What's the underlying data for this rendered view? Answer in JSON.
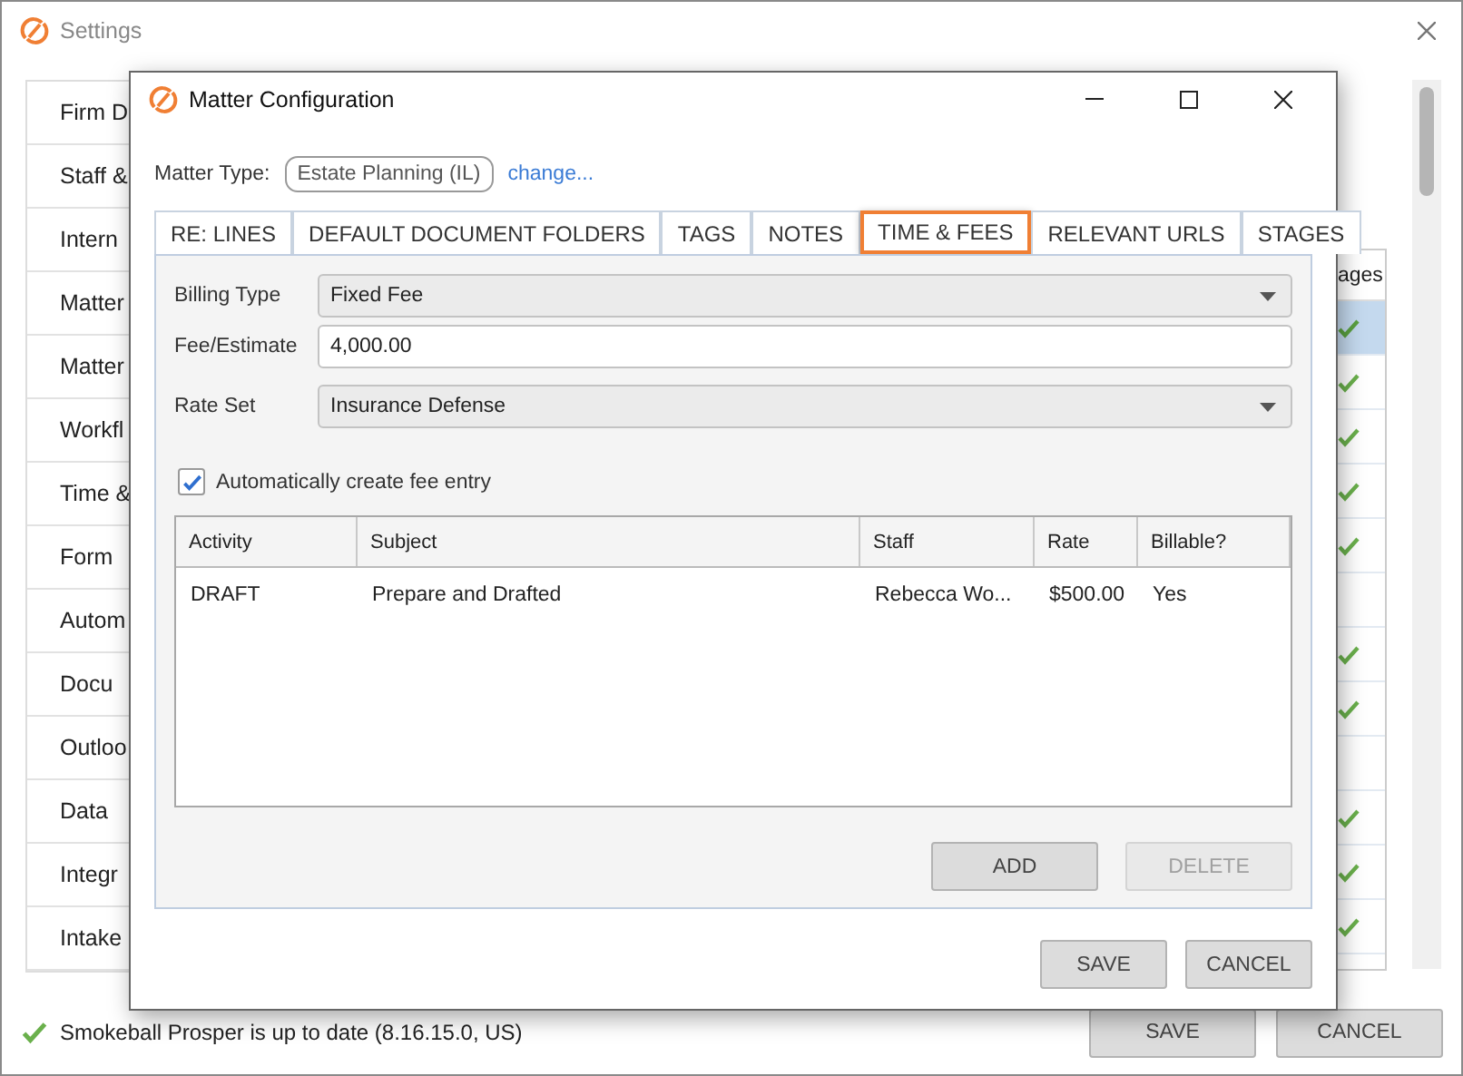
{
  "settings": {
    "title": "Settings",
    "nav_items": [
      {
        "label": "Firm D"
      },
      {
        "label": "Staff &"
      },
      {
        "label": "Intern"
      },
      {
        "label": "Matter"
      },
      {
        "label": "Matter"
      },
      {
        "label": "Workfl"
      },
      {
        "label": "Time &"
      },
      {
        "label": "Form"
      },
      {
        "label": "Autom"
      },
      {
        "label": "Docu"
      },
      {
        "label": "Outloo"
      },
      {
        "label": "Data"
      },
      {
        "label": "Integr"
      },
      {
        "label": "Intake"
      }
    ],
    "column_header": "ages",
    "rows": [
      {
        "checked": true,
        "selected": true
      },
      {
        "checked": true,
        "selected": false
      },
      {
        "checked": true,
        "selected": false
      },
      {
        "checked": true,
        "selected": false
      },
      {
        "checked": true,
        "selected": false
      },
      {
        "checked": false,
        "selected": false
      },
      {
        "checked": true,
        "selected": false
      },
      {
        "checked": true,
        "selected": false
      },
      {
        "checked": false,
        "selected": false
      },
      {
        "checked": true,
        "selected": false
      },
      {
        "checked": true,
        "selected": false
      },
      {
        "checked": true,
        "selected": false
      }
    ],
    "status": "Smokeball Prosper is up to date (8.16.15.0, US)",
    "buttons": [
      {
        "label": "SAVE"
      },
      {
        "label": "CANCEL"
      }
    ]
  },
  "dialog": {
    "title": "Matter Configuration",
    "matter_type": {
      "label": "Matter Type:",
      "value": "Estate Planning (IL)",
      "link": "change..."
    },
    "tabs": [
      {
        "label": "RE: LINES",
        "selected": false
      },
      {
        "label": "DEFAULT DOCUMENT FOLDERS",
        "selected": false
      },
      {
        "label": "TAGS",
        "selected": false
      },
      {
        "label": "NOTES",
        "selected": false
      },
      {
        "label": "TIME & FEES",
        "selected": true
      },
      {
        "label": "RELEVANT URLS",
        "selected": false
      },
      {
        "label": "STAGES",
        "selected": false
      }
    ],
    "fields": [
      {
        "kind": "select",
        "label": "Billing Type",
        "value": "Fixed Fee"
      },
      {
        "kind": "input",
        "label": "Fee/Estimate",
        "value": "4,000.00"
      },
      {
        "kind": "select",
        "label": "Rate Set",
        "value": "Insurance Defense"
      }
    ],
    "checkbox": {
      "label": "Automatically create fee entry",
      "checked": true
    },
    "table": {
      "columns": [
        "Activity",
        "Subject",
        "Staff",
        "Rate",
        "Billable?"
      ],
      "rows": [
        [
          "DRAFT",
          "Prepare and Drafted",
          "Rebecca Wo...",
          "$500.00",
          "Yes"
        ]
      ]
    },
    "panel_buttons": [
      {
        "label": "ADD",
        "disabled": false
      },
      {
        "label": "DELETE",
        "disabled": true
      }
    ],
    "buttons": [
      {
        "label": "SAVE"
      },
      {
        "label": "CANCEL"
      }
    ]
  }
}
